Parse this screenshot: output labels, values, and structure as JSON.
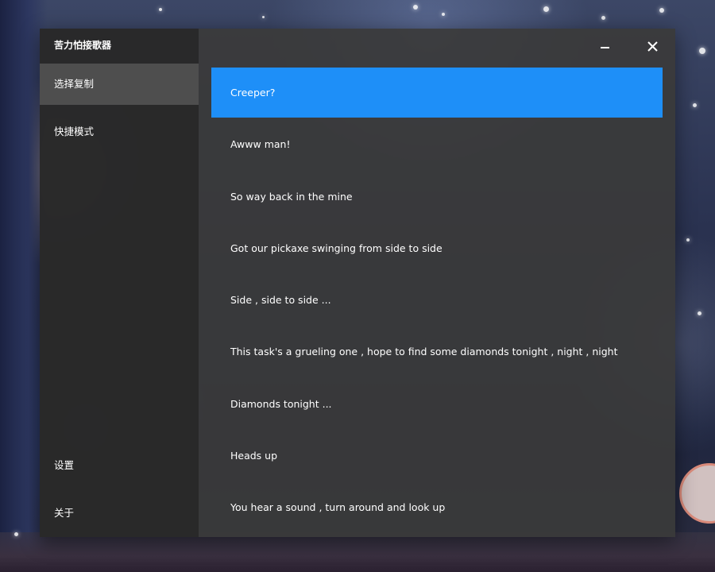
{
  "app": {
    "title": "苦力怕接歌器"
  },
  "sidebar": {
    "items": [
      {
        "label": "选择复制",
        "active": true
      },
      {
        "label": "快捷模式",
        "active": false
      }
    ],
    "bottom_items": [
      {
        "label": "设置"
      },
      {
        "label": "关于"
      }
    ]
  },
  "window_controls": {
    "minimize_icon": "minimize-icon",
    "close_icon": "close-icon"
  },
  "lyrics": {
    "selected_index": 0,
    "lines": [
      "Creeper?",
      "Awww man!",
      "So way back in the mine",
      "Got our pickaxe swinging from side to side",
      "Side , side to side ...",
      "This task's a grueling one , hope to find some diamonds tonight , night , night",
      "Diamonds tonight ...",
      "Heads up",
      "You hear a sound , turn around and look up"
    ]
  },
  "colors": {
    "accent": "#1e8ff8",
    "sidebar_bg": "#282828",
    "sidebar_active": "#505050",
    "content_bg": "#3a3a3a",
    "text": "#ffffff"
  }
}
